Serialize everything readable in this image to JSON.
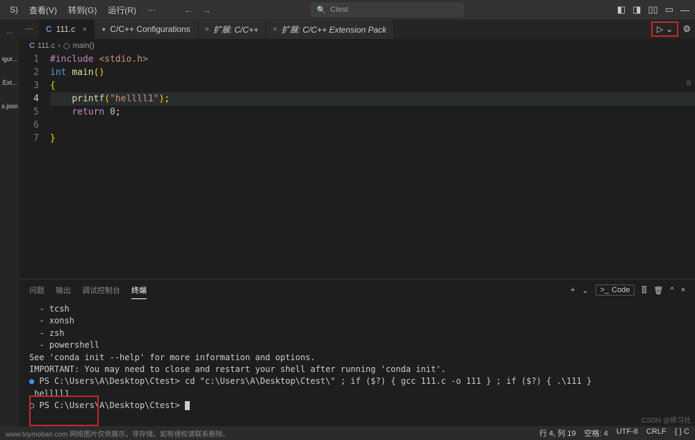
{
  "menu": {
    "s": "S)",
    "view": "查看(V)",
    "goto": "转到(G)",
    "run": "运行(R)",
    "more": "···"
  },
  "search": {
    "placeholder": "Ctest",
    "icon": "🔍"
  },
  "titlebar_icons": {
    "layout1": "▢",
    "layout2": "▢",
    "layout3": "⫿⫿",
    "panel": "▭",
    "min": "—"
  },
  "sidebar": {
    "items": [
      {
        "label": "igur..."
      },
      {
        "label": "Ext..."
      },
      {
        "label": "s.json"
      }
    ]
  },
  "tabs": {
    "dots": "···",
    "list": [
      {
        "icon": "C",
        "label": "111.c",
        "active": true,
        "close": "×",
        "italic": false
      },
      {
        "icon": "●",
        "label": "C/C++ Configurations",
        "active": false,
        "close": "",
        "italic": false
      },
      {
        "icon": "≡",
        "label": "扩展: C/C++",
        "active": false,
        "close": "",
        "italic": true
      },
      {
        "icon": "≡",
        "label": "扩展: C/C++ Extension Pack",
        "active": false,
        "close": "",
        "italic": true
      }
    ],
    "run_icon": "▷",
    "run_chevron": "⌄",
    "gear": "⚙"
  },
  "breadcrumb": {
    "file_icon": "C",
    "file": "111.c",
    "sep": "›",
    "fn_icon": "⬡",
    "fn": "main()"
  },
  "code": {
    "lines": [
      1,
      2,
      3,
      4,
      5,
      6,
      7
    ],
    "current_line": 4,
    "l1_pp": "#include ",
    "l1_inc": "<stdio.h>",
    "l2_type": "int ",
    "l2_fn": "main",
    "l2_paren": "()",
    "l3": "{",
    "l4_fn": "printf",
    "l4_open": "(",
    "l4_str": "\"hellll1\"",
    "l4_close": ");",
    "l5_kw": "return ",
    "l5_num": "0",
    "l5_semi": ";",
    "l7": "}"
  },
  "panel": {
    "tabs": {
      "problems": "问题",
      "output": "输出",
      "debug": "调试控制台",
      "terminal": "终端"
    },
    "actions": {
      "add": "+",
      "chevron": "⌄",
      "code_icon": ">_",
      "code_label": "Code",
      "split": "⫿⫿",
      "trash": "🗑",
      "up": "^",
      "close": "×"
    }
  },
  "terminal": {
    "lines": [
      "  - tcsh",
      "  - xonsh",
      "  - zsh",
      "  - powershell",
      "",
      "See 'conda init --help' for more information and options.",
      "",
      "IMPORTANT: You may need to close and restart your shell after running 'conda init'.",
      ""
    ],
    "prompt1_dot": "●",
    "prompt1_prefix": "PS C:\\Users\\A\\Desktop\\Ctest> ",
    "prompt1_cmd": "cd \"c:\\Users\\A\\Desktop\\Ctest\\\" ; if ($?) { gcc 111.c -o 111 } ; if ($?) { .\\111 }",
    "output1": " hellll1",
    "prompt2_dot": "○",
    "prompt2_prefix": "PS C:\\Users\\A\\Desktop\\Ctest> "
  },
  "statusbar": {
    "watermark": "www.toymoban.com 网络图片仅供展示，非存储，如有侵权请联系删除。",
    "ln_col": "行 4, 列 19",
    "spaces": "空格: 4",
    "encoding": "UTF-8",
    "eol": "CRLF",
    "lang": "{ } C"
  },
  "corner_watermark": "CSDN @修习社"
}
